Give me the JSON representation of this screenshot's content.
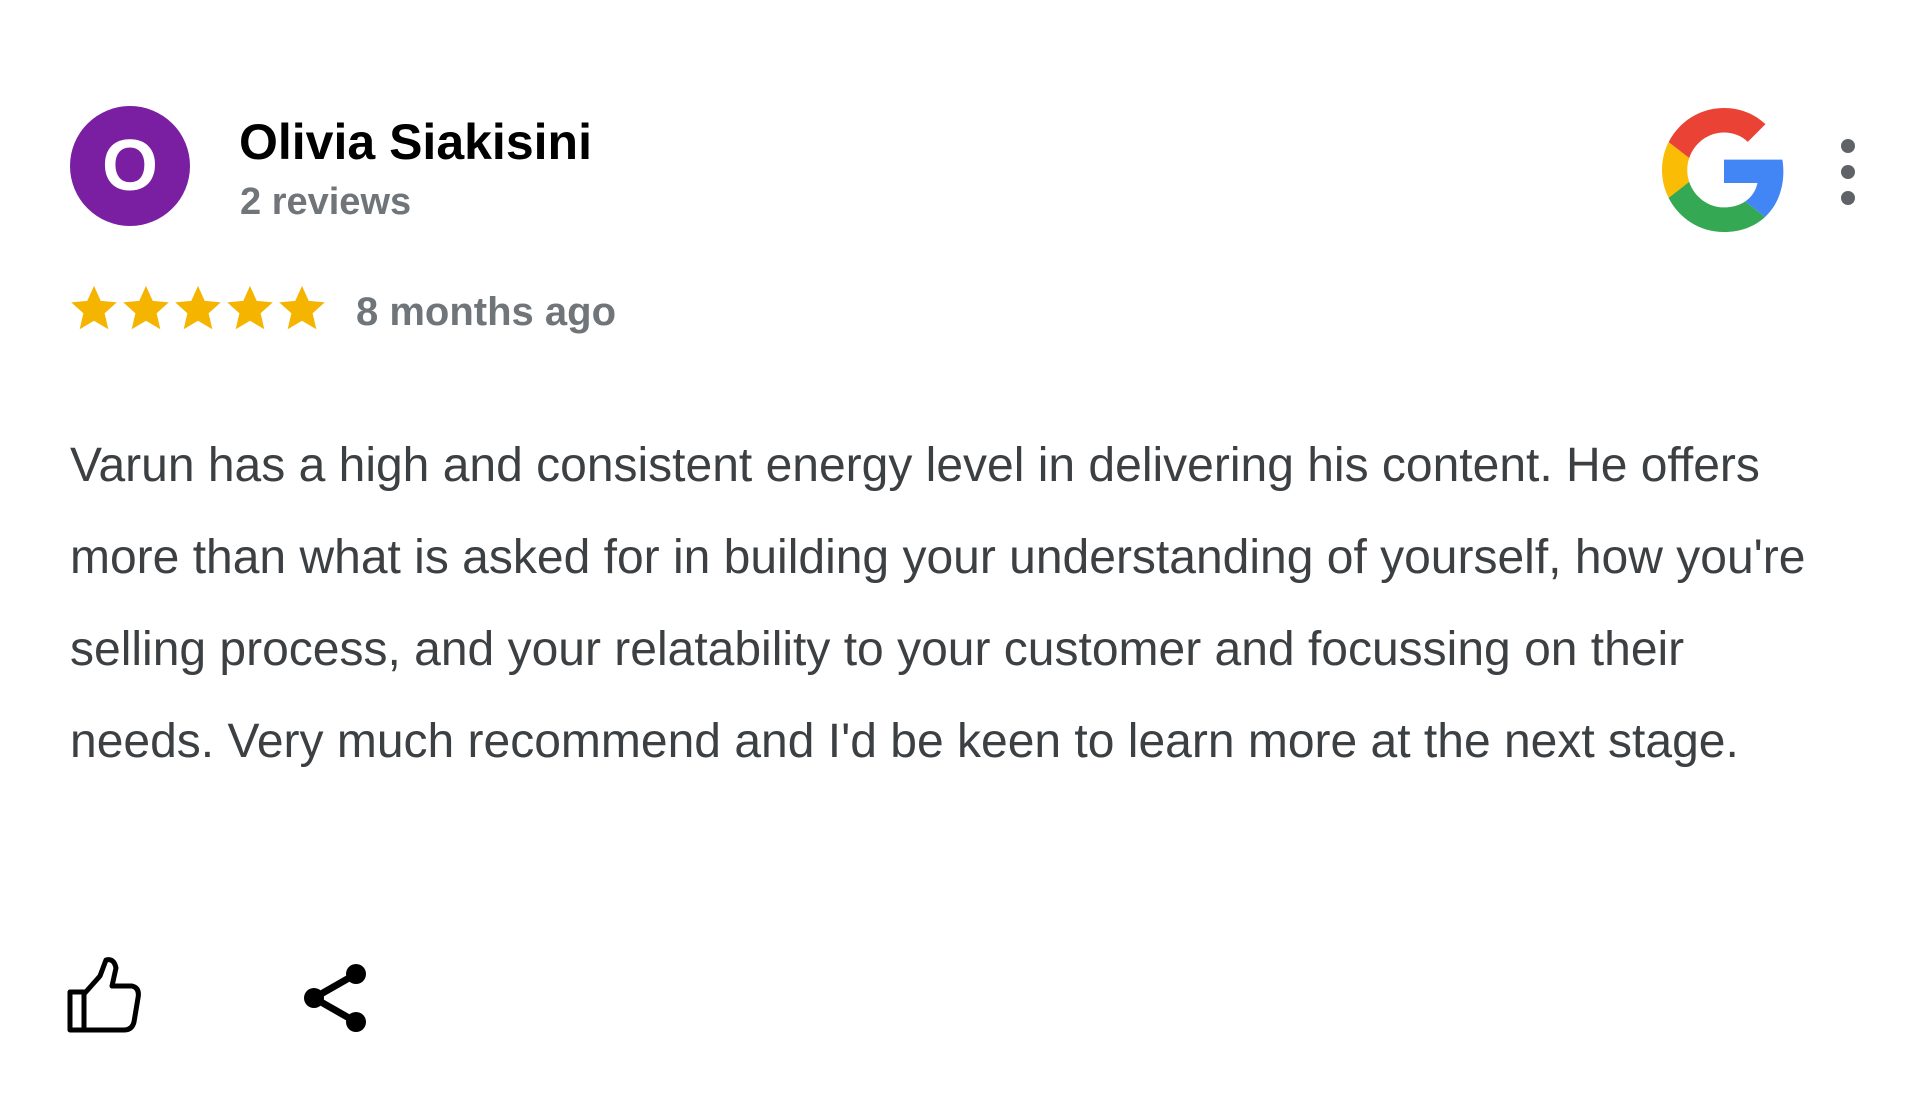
{
  "review": {
    "author": {
      "initial": "O",
      "name": "Olivia Siakisini",
      "review_count": "2 reviews",
      "avatar_color": "#7b1fa2"
    },
    "rating": 5,
    "rating_max": 5,
    "time": "8 months ago",
    "text": "Varun has a high and consistent energy level in delivering his content. He offers more than what is asked for in building your understanding of yourself, how you're selling process, and your relatability to your customer and focussing on their needs. Very much recommend and I'd be keen to learn more at the next stage."
  },
  "icons": {
    "source_logo": "google-logo",
    "menu": "more-vert-icon",
    "star": "star-icon",
    "like": "thumbs-up-icon",
    "share": "share-icon"
  },
  "colors": {
    "star": "#f4b400",
    "meta_text": "#70757a",
    "body_text": "#3c4043",
    "google_red": "#ea4335",
    "google_yellow": "#fbbc05",
    "google_green": "#34a853",
    "google_blue": "#4285f4"
  }
}
